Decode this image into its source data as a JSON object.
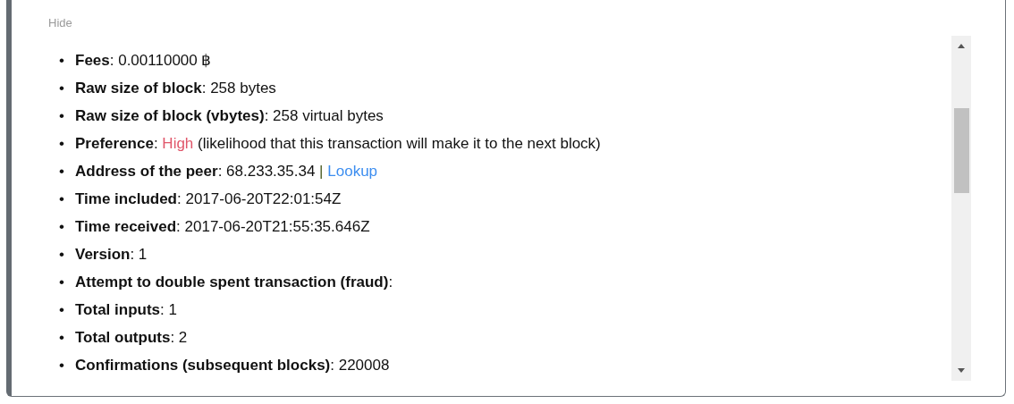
{
  "hide_link": "Hide",
  "details": [
    {
      "marker": "•",
      "parts": [
        {
          "kind": "label",
          "text": "Fees"
        },
        {
          "kind": "plain",
          "text": ": 0.00110000 ฿"
        }
      ]
    },
    {
      "marker": "•",
      "parts": [
        {
          "kind": "label",
          "text": "Raw size of block"
        },
        {
          "kind": "plain",
          "text": ": 258 bytes"
        }
      ]
    },
    {
      "marker": "•",
      "parts": [
        {
          "kind": "label",
          "text": "Raw size of block (vbytes)"
        },
        {
          "kind": "plain",
          "text": ": 258 virtual bytes"
        }
      ]
    },
    {
      "marker": "•",
      "parts": [
        {
          "kind": "label",
          "text": "Preference"
        },
        {
          "kind": "plain",
          "text": ":"
        },
        {
          "kind": "highlight",
          "text": "High"
        },
        {
          "kind": "plain",
          "text": "(likelihood that this transaction will make it to the next block)"
        }
      ]
    },
    {
      "marker": "•",
      "parts": [
        {
          "kind": "label",
          "text": "Address of the peer"
        },
        {
          "kind": "plain",
          "text": ": 68.233.35.34"
        },
        {
          "kind": "separator",
          "text": "|"
        },
        {
          "kind": "link",
          "text": "Lookup"
        }
      ]
    },
    {
      "marker": "•",
      "parts": [
        {
          "kind": "label",
          "text": "Time included"
        },
        {
          "kind": "plain",
          "text": ": 2017-06-20T22:01:54Z"
        }
      ]
    },
    {
      "marker": "•",
      "parts": [
        {
          "kind": "label",
          "text": "Time received"
        },
        {
          "kind": "plain",
          "text": ": 2017-06-20T21:55:35.646Z"
        }
      ]
    },
    {
      "marker": "•",
      "parts": [
        {
          "kind": "label",
          "text": "Version"
        },
        {
          "kind": "plain",
          "text": ": 1"
        }
      ]
    },
    {
      "marker": "•",
      "parts": [
        {
          "kind": "label",
          "text": "Attempt to double spent transaction (fraud)"
        },
        {
          "kind": "plain",
          "text": ":"
        }
      ]
    },
    {
      "marker": "•",
      "parts": [
        {
          "kind": "label",
          "text": "Total inputs"
        },
        {
          "kind": "plain",
          "text": ": 1"
        }
      ]
    },
    {
      "marker": "•",
      "parts": [
        {
          "kind": "label",
          "text": "Total outputs"
        },
        {
          "kind": "plain",
          "text": ": 2"
        }
      ]
    },
    {
      "marker": "•",
      "parts": [
        {
          "kind": "label",
          "text": "Confirmations (subsequent blocks)"
        },
        {
          "kind": "plain",
          "text": ": 220008"
        }
      ]
    }
  ]
}
